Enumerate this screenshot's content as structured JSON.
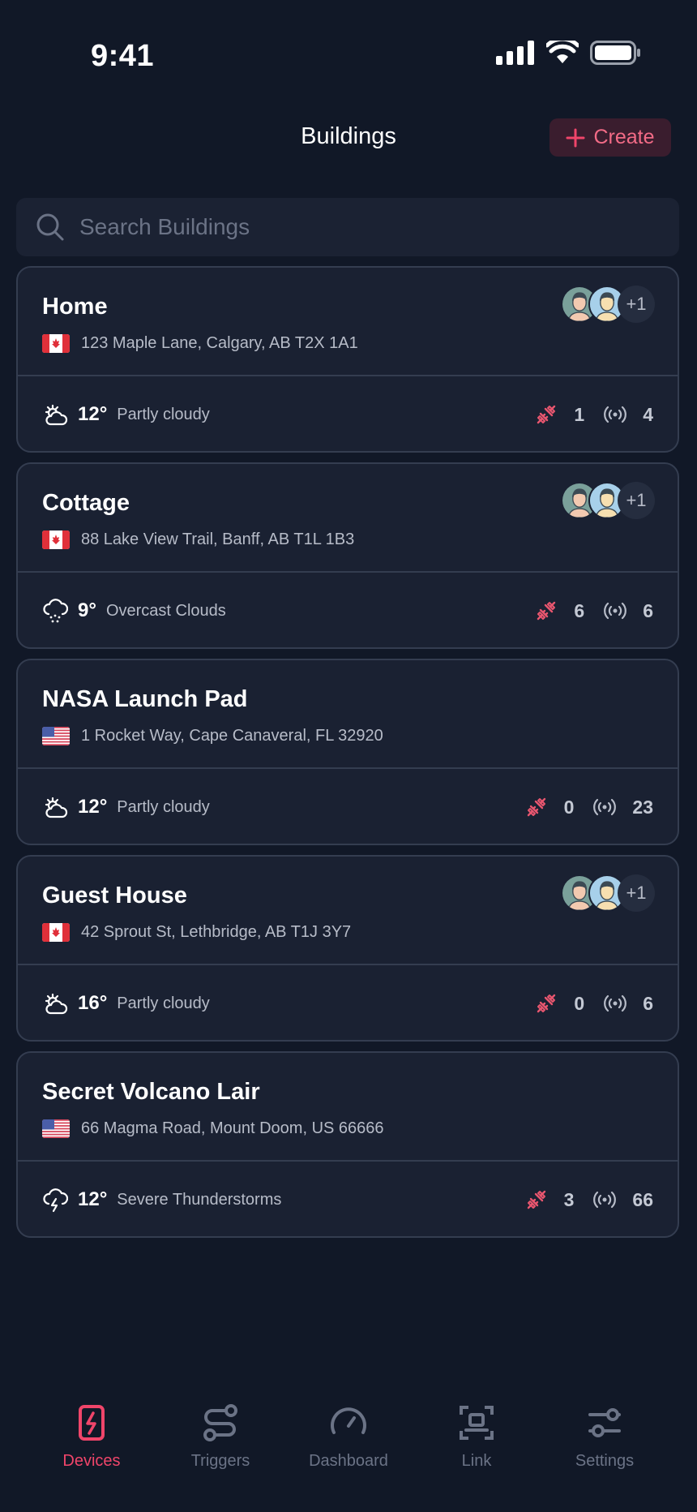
{
  "status_bar": {
    "time": "9:41"
  },
  "header": {
    "title": "Buildings",
    "create_label": "Create"
  },
  "search": {
    "placeholder": "Search Buildings"
  },
  "buildings": [
    {
      "name": "Home",
      "country": "CA",
      "address": "123 Maple Lane, Calgary, AB T2X 1A1",
      "has_members": true,
      "members_more": "+1",
      "weather_icon": "partly-cloudy-icon",
      "temp": "12°",
      "weather": "Partly cloudy",
      "devices_offline": "1",
      "devices_online": "4"
    },
    {
      "name": "Cottage",
      "country": "CA",
      "address": "88 Lake View Trail, Banff, AB T1L 1B3",
      "has_members": true,
      "members_more": "+1",
      "weather_icon": "overcast-clouds-icon",
      "temp": "9°",
      "weather": "Overcast Clouds",
      "devices_offline": "6",
      "devices_online": "6"
    },
    {
      "name": "NASA Launch Pad",
      "country": "US",
      "address": "1 Rocket Way, Cape Canaveral, FL 32920",
      "has_members": false,
      "members_more": "",
      "weather_icon": "partly-cloudy-icon",
      "temp": "12°",
      "weather": "Partly cloudy",
      "devices_offline": "0",
      "devices_online": "23"
    },
    {
      "name": "Guest House",
      "country": "CA",
      "address": "42 Sprout St, Lethbridge, AB T1J 3Y7",
      "has_members": true,
      "members_more": "+1",
      "weather_icon": "partly-cloudy-icon",
      "temp": "16°",
      "weather": "Partly cloudy",
      "devices_offline": "0",
      "devices_online": "6"
    },
    {
      "name": "Secret Volcano Lair",
      "country": "US",
      "address": "66 Magma Road, Mount Doom, US 66666",
      "has_members": false,
      "members_more": "",
      "weather_icon": "thunderstorm-icon",
      "temp": "12°",
      "weather": "Severe Thunderstorms",
      "devices_offline": "3",
      "devices_online": "66"
    }
  ],
  "nav": {
    "devices": "Devices",
    "triggers": "Triggers",
    "dashboard": "Dashboard",
    "link": "Link",
    "settings": "Settings",
    "active": "devices"
  },
  "colors": {
    "background": "#111827",
    "card": "#1a2132",
    "accent": "#f0456a",
    "offline": "#e8566f"
  }
}
